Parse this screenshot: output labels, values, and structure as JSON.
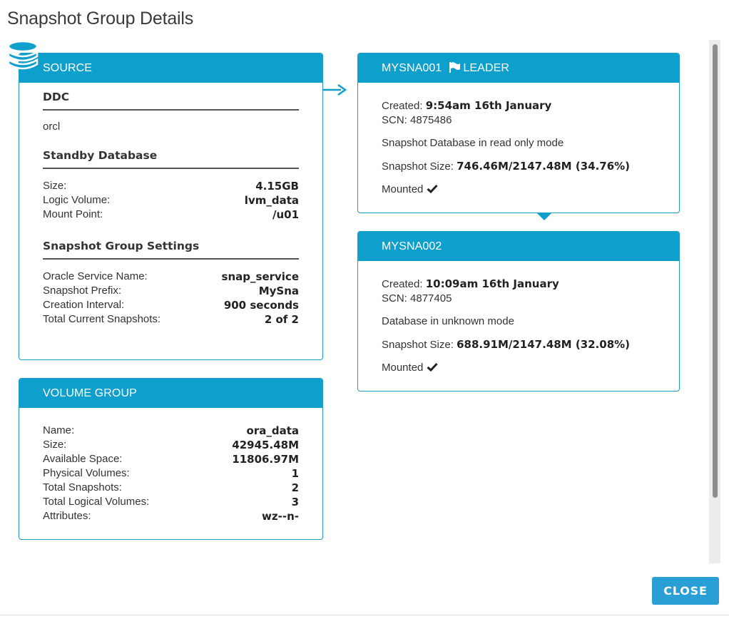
{
  "dialog": {
    "title": "Snapshot Group Details",
    "close_label": "CLOSE"
  },
  "colors": {
    "header": "#0e9fcd",
    "border": "#1a9bc9",
    "button": "#2a9fd6"
  },
  "source": {
    "header": "SOURCE",
    "ddc_title": "DDC",
    "ddc_value": "orcl",
    "standby_title": "Standby Database",
    "standby": [
      {
        "label": "Size:",
        "value": "4.15GB"
      },
      {
        "label": "Logic Volume:",
        "value": "lvm_data"
      },
      {
        "label": "Mount Point:",
        "value": "/u01"
      }
    ],
    "settings_title": "Snapshot Group Settings",
    "settings": [
      {
        "label": "Oracle Service Name:",
        "value": "snap_service"
      },
      {
        "label": "Snapshot Prefix:",
        "value": "MySna"
      },
      {
        "label": "Creation Interval:",
        "value": "900 seconds"
      },
      {
        "label": "Total Current Snapshots:",
        "value": "2 of 2"
      }
    ]
  },
  "volume_group": {
    "header": "VOLUME GROUP",
    "rows": [
      {
        "label": "Name:",
        "value": "ora_data"
      },
      {
        "label": "Size:",
        "value": "42945.48M"
      },
      {
        "label": "Available Space:",
        "value": "11806.97M"
      },
      {
        "label": "Physical Volumes:",
        "value": "1"
      },
      {
        "label": "Total Snapshots:",
        "value": "2"
      },
      {
        "label": "Total Logical Volumes:",
        "value": "3"
      },
      {
        "label": "Attributes:",
        "value": "wz--n-"
      }
    ]
  },
  "snapshots": [
    {
      "name": "MYSNA001",
      "badge": "LEADER",
      "created_label": "Created:",
      "created_value": "9:54am 16th January",
      "scn_label": "SCN:",
      "scn_value": "4875486",
      "mode": "Snapshot Database in read only mode",
      "size_label": "Snapshot Size:",
      "size_value": "746.46M/2147.48M (34.76%)",
      "mounted": "Mounted"
    },
    {
      "name": "MYSNA002",
      "created_label": "Created:",
      "created_value": "10:09am 16th January",
      "scn_label": "SCN:",
      "scn_value": "4877405",
      "mode": "Database in unknown mode",
      "size_label": "Snapshot Size:",
      "size_value": "688.91M/2147.48M (32.08%)",
      "mounted": "Mounted"
    }
  ]
}
